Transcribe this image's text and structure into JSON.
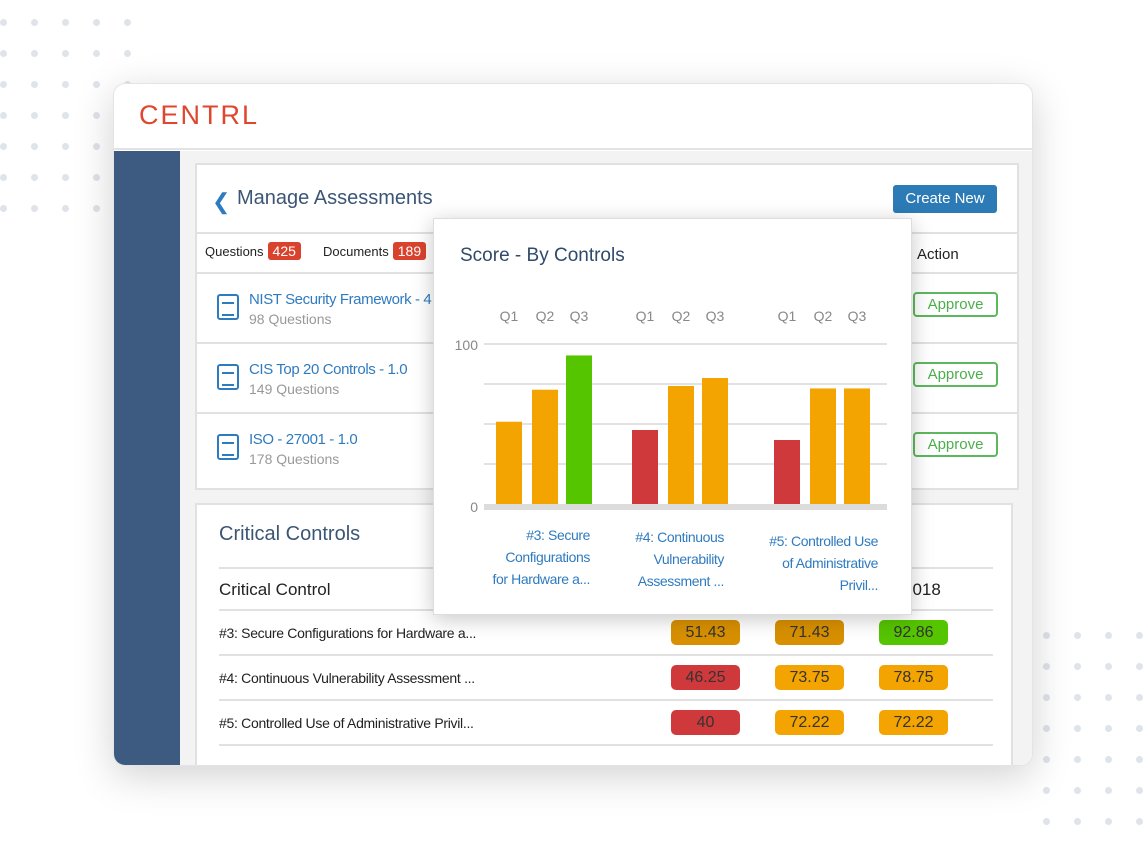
{
  "logo": "CENTRL",
  "header": {
    "title": "Manage Assessments",
    "create_label": "Create New"
  },
  "tabs": [
    {
      "label": "Questions",
      "count": "425"
    },
    {
      "label": "Documents",
      "count": "189"
    }
  ],
  "action_header": "Action",
  "assessments": [
    {
      "name": "NIST Security Framework - 4",
      "sub": "98 Questions",
      "action": "Approve"
    },
    {
      "name": "CIS Top 20 Controls - 1.0",
      "sub": "149 Questions",
      "action": "Approve"
    },
    {
      "name": "ISO - 27001 - 1.0",
      "sub": "178 Questions",
      "action": "Approve"
    }
  ],
  "critical": {
    "title": "Critical Controls",
    "col_header": "Critical Control",
    "col_last": "2018",
    "rows": [
      {
        "label": "#3: Secure Configurations for Hardware a...",
        "scores": [
          "51.43",
          "71.43",
          "92.86"
        ],
        "colors": [
          "#d89000",
          "#d89000",
          "#55c500"
        ]
      },
      {
        "label": "#4: Continuous Vulnerability Assessment ...",
        "scores": [
          "46.25",
          "73.75",
          "78.75"
        ],
        "colors": [
          "#d0393b",
          "#f3a400",
          "#f3a400"
        ]
      },
      {
        "label": "#5: Controlled Use of Administrative Privil...",
        "scores": [
          "40",
          "72.22",
          "72.22"
        ],
        "colors": [
          "#d0393b",
          "#f3a400",
          "#f3a400"
        ]
      }
    ]
  },
  "chart_data": {
    "type": "bar",
    "title": "Score - By Controls",
    "ylim": [
      0,
      100
    ],
    "yticks": [
      "0",
      "100"
    ],
    "grid": true,
    "subcategories": [
      "Q1",
      "Q2",
      "Q3"
    ],
    "categories": [
      "#3: Secure Configurations for Hardware a...",
      "#4: Continuous Vulnerability Assessment ...",
      "#5: Controlled Use of Administrative Privil..."
    ],
    "category_lines": [
      [
        "#3: Secure",
        "Configurations",
        "for Hardware a..."
      ],
      [
        "#4: Continuous",
        "Vulnerability",
        "Assessment ..."
      ],
      [
        "#5: Controlled Use",
        "of Administrative",
        "Privil..."
      ]
    ],
    "values": [
      [
        51.43,
        71.43,
        92.86
      ],
      [
        46.25,
        73.75,
        78.75
      ],
      [
        40,
        72.22,
        72.22
      ]
    ],
    "colors": [
      [
        "#f3a400",
        "#f3a400",
        "#55c500"
      ],
      [
        "#d0393b",
        "#f3a400",
        "#f3a400"
      ],
      [
        "#d0393b",
        "#f3a400",
        "#f3a400"
      ]
    ]
  }
}
